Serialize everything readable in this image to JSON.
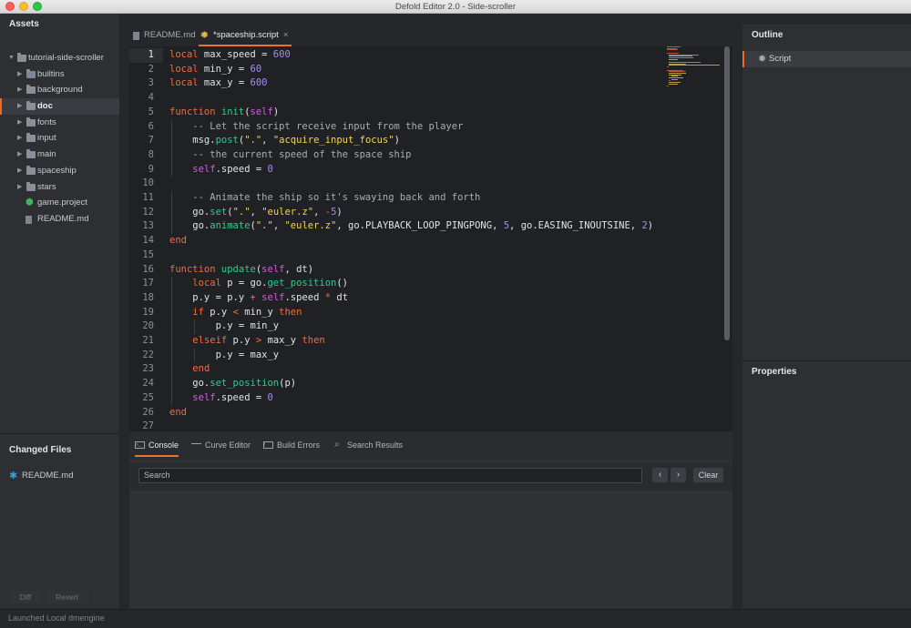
{
  "window": {
    "title": "Defold Editor 2.0 - Side-scroller"
  },
  "assets": {
    "title": "Assets",
    "tree": [
      {
        "label": "tutorial-side-scroller",
        "type": "folder",
        "expanded": true
      },
      {
        "label": "builtins",
        "type": "folder-special"
      },
      {
        "label": "background",
        "type": "folder"
      },
      {
        "label": "doc",
        "type": "folder",
        "selected": true
      },
      {
        "label": "fonts",
        "type": "folder"
      },
      {
        "label": "input",
        "type": "folder"
      },
      {
        "label": "main",
        "type": "folder"
      },
      {
        "label": "spaceship",
        "type": "folder"
      },
      {
        "label": "stars",
        "type": "folder"
      },
      {
        "label": "game.project",
        "type": "project-file"
      },
      {
        "label": "README.md",
        "type": "text-file"
      }
    ]
  },
  "changed_files": {
    "title": "Changed Files",
    "files": [
      {
        "label": "README.md",
        "icon": "asterisk-icon"
      }
    ],
    "diff_label": "Diff",
    "revert_label": "Revert"
  },
  "editor_tabs": [
    {
      "label": "README.md",
      "icon": "document-icon",
      "active": false
    },
    {
      "label": "*spaceship.script",
      "icon": "gear-icon",
      "active": true
    }
  ],
  "code_lines": [
    "local max_speed = 600",
    "local min_y = 60",
    "local max_y = 600",
    "",
    "function init(self)",
    "    -- Let the script receive input from the player",
    "    msg.post(\".\", \"acquire_input_focus\")",
    "    -- the current speed of the space ship",
    "    self.speed = 0",
    "",
    "    -- Animate the ship so it's swaying back and forth",
    "    go.set(\".\", \"euler.z\", -5)",
    "    go.animate(\".\", \"euler.z\", go.PLAYBACK_LOOP_PINGPONG, 5, go.EASING_INOUTSINE, 2)",
    "end",
    "",
    "function update(self, dt)",
    "    local p = go.get_position()",
    "    p.y = p.y + self.speed * dt",
    "    if p.y < min_y then",
    "        p.y = min_y",
    "    elseif p.y > max_y then",
    "        p.y = max_y",
    "    end",
    "    go.set_position(p)",
    "    self.speed = 0",
    "end",
    ""
  ],
  "current_line": 1,
  "syntax_colors": {
    "keyword": "#f26d3d",
    "number": "#a78bf0",
    "string": "#f3d64e",
    "comment": "#a9adb3",
    "function": "#36c98b",
    "self": "#d35de0"
  },
  "bottom_tabs": [
    {
      "label": "Console",
      "icon": "console-icon",
      "active": true
    },
    {
      "label": "Curve Editor",
      "icon": "curve-icon",
      "active": false
    },
    {
      "label": "Build Errors",
      "icon": "build-errors-icon",
      "active": false
    },
    {
      "label": "Search Results",
      "icon": "search-icon",
      "active": false
    }
  ],
  "console": {
    "search_placeholder": "Search",
    "prev_label": "‹",
    "next_label": "›",
    "clear_label": "Clear"
  },
  "outline": {
    "title": "Outline",
    "items": [
      {
        "label": "Script",
        "icon": "gear-icon"
      }
    ]
  },
  "properties": {
    "title": "Properties"
  },
  "status": {
    "text": "Launched Local dmengine"
  },
  "accent_color": "#e8752f"
}
